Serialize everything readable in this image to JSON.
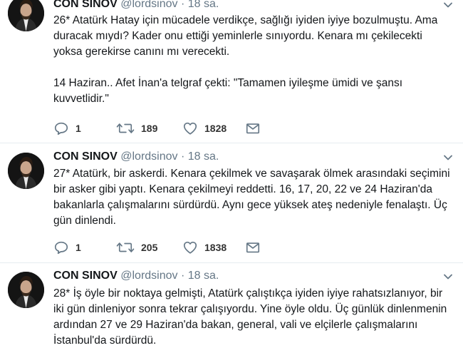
{
  "tweets": [
    {
      "name": "CON SINOV",
      "handle": "@lordsinov",
      "dot": "·",
      "time": "18 sa.",
      "text": "26* Atatürk Hatay için mücadele verdikçe, sağlığı iyiden iyiye bozulmuştu. Ama duracak mıydı? Kader onu ettiği yeminlerle sınıyordu. Kenara mı çekilecekti yoksa gerekirse canını mı verecekti.\n\n14 Haziran.. Afet İnan'a telgraf çekti: \"Tamamen iyileşme ümidi ve şansı kuvvetlidir.\"",
      "replies": "1",
      "retweets": "189",
      "likes": "1828"
    },
    {
      "name": "CON SINOV",
      "handle": "@lordsinov",
      "dot": "·",
      "time": "18 sa.",
      "text": "27* Atatürk, bir askerdi. Kenara çekilmek ve savaşarak ölmek arasındaki seçimini bir asker gibi yaptı. Kenara çekilmeyi reddetti. 16, 17, 20, 22 ve 24 Haziran'da bakanlarla çalışmalarını sürdürdü. Aynı gece yüksek ateş nedeniyle fenalaştı. Üç gün dinlendi.",
      "replies": "1",
      "retweets": "205",
      "likes": "1838"
    },
    {
      "name": "CON SINOV",
      "handle": "@lordsinov",
      "dot": "·",
      "time": "18 sa.",
      "text": "28* İş öyle bir noktaya gelmişti, Atatürk çalıştıkça iyiden iyiye rahatsızlanıyor, bir iki gün dinleniyor sonra tekrar çalışıyordu. Yine öyle oldu. Üç günlük dinlenmenin ardından 27 ve 29 Haziran'da bakan, general, vali ve elçilerle çalışmalarını İstanbul'da sürdürdü."
    }
  ],
  "icons": {
    "reply": "reply-icon",
    "retweet": "retweet-icon",
    "like": "heart-icon",
    "dm": "envelope-icon",
    "more": "chevron-down-icon"
  },
  "colors": {
    "icon": "#657786",
    "divider": "#e6ecf0",
    "text": "#14171a"
  }
}
